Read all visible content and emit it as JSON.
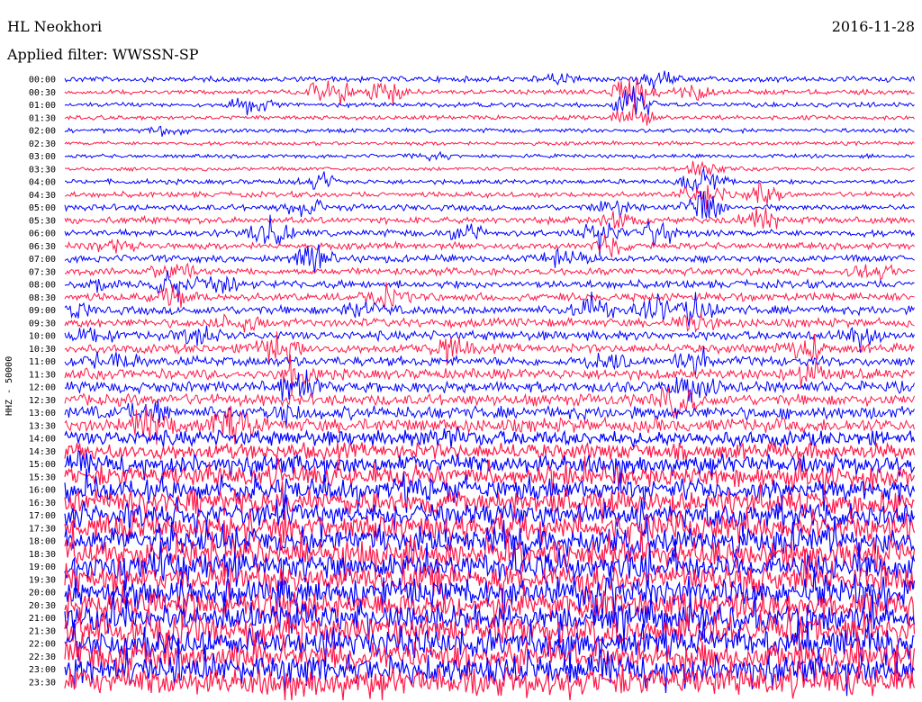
{
  "header": {
    "station": "HL Neokhori",
    "date": "2016-11-28",
    "filter": "Applied filter: WWSSN-SP"
  },
  "chart_data": {
    "type": "line",
    "title": "HL Neokhori",
    "subtitle": "Applied filter: WWSSN-SP",
    "ylabel": "HHZ - 50000",
    "xlabel": "",
    "colors": [
      "#0000ff",
      "#ff1a4a"
    ],
    "rows": [
      {
        "label": "00:00",
        "activity": 0.15,
        "events": [
          [
            0.58,
            0.3
          ],
          [
            0.7,
            0.5
          ]
        ]
      },
      {
        "label": "00:30",
        "activity": 0.12,
        "events": [
          [
            0.31,
            0.9
          ],
          [
            0.38,
            0.7
          ],
          [
            0.67,
            1.0
          ],
          [
            0.74,
            0.4
          ]
        ]
      },
      {
        "label": "01:00",
        "activity": 0.12,
        "events": [
          [
            0.22,
            0.5
          ],
          [
            0.67,
            0.9
          ]
        ]
      },
      {
        "label": "01:30",
        "activity": 0.1,
        "events": [
          [
            0.67,
            0.6
          ]
        ]
      },
      {
        "label": "02:00",
        "activity": 0.1,
        "events": [
          [
            0.12,
            0.3
          ]
        ]
      },
      {
        "label": "02:30",
        "activity": 0.08,
        "events": []
      },
      {
        "label": "03:00",
        "activity": 0.08,
        "events": [
          [
            0.43,
            0.2
          ]
        ]
      },
      {
        "label": "03:30",
        "activity": 0.08,
        "events": [
          [
            0.75,
            0.5
          ]
        ]
      },
      {
        "label": "04:00",
        "activity": 0.12,
        "events": [
          [
            0.75,
            0.8
          ],
          [
            0.3,
            0.5
          ]
        ]
      },
      {
        "label": "04:30",
        "activity": 0.15,
        "events": [
          [
            0.75,
            0.7
          ],
          [
            0.82,
            0.6
          ]
        ]
      },
      {
        "label": "05:00",
        "activity": 0.18,
        "events": [
          [
            0.28,
            0.5
          ],
          [
            0.75,
            0.8
          ],
          [
            0.65,
            0.6
          ]
        ]
      },
      {
        "label": "05:30",
        "activity": 0.2,
        "events": [
          [
            0.65,
            0.5
          ],
          [
            0.82,
            0.6
          ]
        ]
      },
      {
        "label": "06:00",
        "activity": 0.2,
        "events": [
          [
            0.24,
            1.0
          ],
          [
            0.47,
            0.5
          ],
          [
            0.63,
            0.9
          ],
          [
            0.7,
            0.8
          ]
        ]
      },
      {
        "label": "06:30",
        "activity": 0.2,
        "events": [
          [
            0.06,
            0.4
          ],
          [
            0.64,
            0.5
          ]
        ]
      },
      {
        "label": "07:00",
        "activity": 0.22,
        "events": [
          [
            0.29,
            0.6
          ],
          [
            0.59,
            0.5
          ]
        ]
      },
      {
        "label": "07:30",
        "activity": 0.22,
        "events": [
          [
            0.13,
            0.8
          ],
          [
            0.95,
            0.5
          ]
        ]
      },
      {
        "label": "08:00",
        "activity": 0.25,
        "events": [
          [
            0.04,
            0.6
          ],
          [
            0.13,
            0.9
          ],
          [
            0.19,
            0.5
          ]
        ]
      },
      {
        "label": "08:30",
        "activity": 0.25,
        "events": [
          [
            0.13,
            0.6
          ],
          [
            0.38,
            0.5
          ]
        ]
      },
      {
        "label": "09:00",
        "activity": 0.28,
        "events": [
          [
            0.0,
            0.7
          ],
          [
            0.35,
            0.5
          ],
          [
            0.62,
            0.7
          ],
          [
            0.69,
            0.7
          ],
          [
            0.74,
            0.8
          ]
        ]
      },
      {
        "label": "09:30",
        "activity": 0.28,
        "events": [
          [
            0.2,
            0.5
          ],
          [
            0.74,
            0.6
          ]
        ]
      },
      {
        "label": "10:00",
        "activity": 0.3,
        "events": [
          [
            0.04,
            0.6
          ],
          [
            0.16,
            0.5
          ],
          [
            0.93,
            0.6
          ]
        ]
      },
      {
        "label": "10:30",
        "activity": 0.3,
        "events": [
          [
            0.25,
            0.7
          ],
          [
            0.45,
            0.6
          ],
          [
            0.87,
            0.7
          ]
        ]
      },
      {
        "label": "11:00",
        "activity": 0.32,
        "events": [
          [
            0.06,
            0.6
          ],
          [
            0.64,
            0.7
          ],
          [
            0.74,
            0.8
          ]
        ]
      },
      {
        "label": "11:30",
        "activity": 0.35,
        "events": [
          [
            0.27,
            0.8
          ],
          [
            0.87,
            0.7
          ]
        ]
      },
      {
        "label": "12:00",
        "activity": 0.38,
        "events": [
          [
            0.27,
            0.9
          ],
          [
            0.74,
            0.7
          ]
        ]
      },
      {
        "label": "12:30",
        "activity": 0.4,
        "events": [
          [
            0.72,
            0.8
          ]
        ]
      },
      {
        "label": "13:00",
        "activity": 0.45,
        "events": [
          [
            0.1,
            0.6
          ],
          [
            0.25,
            0.6
          ]
        ]
      },
      {
        "label": "13:30",
        "activity": 0.5,
        "events": [
          [
            0.1,
            0.9
          ],
          [
            0.2,
            0.9
          ]
        ]
      },
      {
        "label": "14:00",
        "activity": 0.55,
        "events": [
          [
            0.45,
            0.6
          ]
        ]
      },
      {
        "label": "14:30",
        "activity": 0.6,
        "events": []
      },
      {
        "label": "15:00",
        "activity": 0.65,
        "events": []
      },
      {
        "label": "15:30",
        "activity": 0.7,
        "events": []
      },
      {
        "label": "16:00",
        "activity": 0.75,
        "events": []
      },
      {
        "label": "16:30",
        "activity": 0.8,
        "events": []
      },
      {
        "label": "17:00",
        "activity": 0.85,
        "events": []
      },
      {
        "label": "17:30",
        "activity": 0.9,
        "events": []
      },
      {
        "label": "18:00",
        "activity": 0.95,
        "events": []
      },
      {
        "label": "18:30",
        "activity": 1.0,
        "events": []
      },
      {
        "label": "19:00",
        "activity": 1.0,
        "events": []
      },
      {
        "label": "19:30",
        "activity": 1.0,
        "events": []
      },
      {
        "label": "20:00",
        "activity": 1.0,
        "events": []
      },
      {
        "label": "20:30",
        "activity": 1.0,
        "events": []
      },
      {
        "label": "21:00",
        "activity": 1.0,
        "events": []
      },
      {
        "label": "21:30",
        "activity": 1.0,
        "events": []
      },
      {
        "label": "22:00",
        "activity": 1.0,
        "events": []
      },
      {
        "label": "22:30",
        "activity": 1.0,
        "events": []
      },
      {
        "label": "23:00",
        "activity": 1.0,
        "events": []
      },
      {
        "label": "23:30",
        "activity": 1.0,
        "events": []
      }
    ]
  }
}
